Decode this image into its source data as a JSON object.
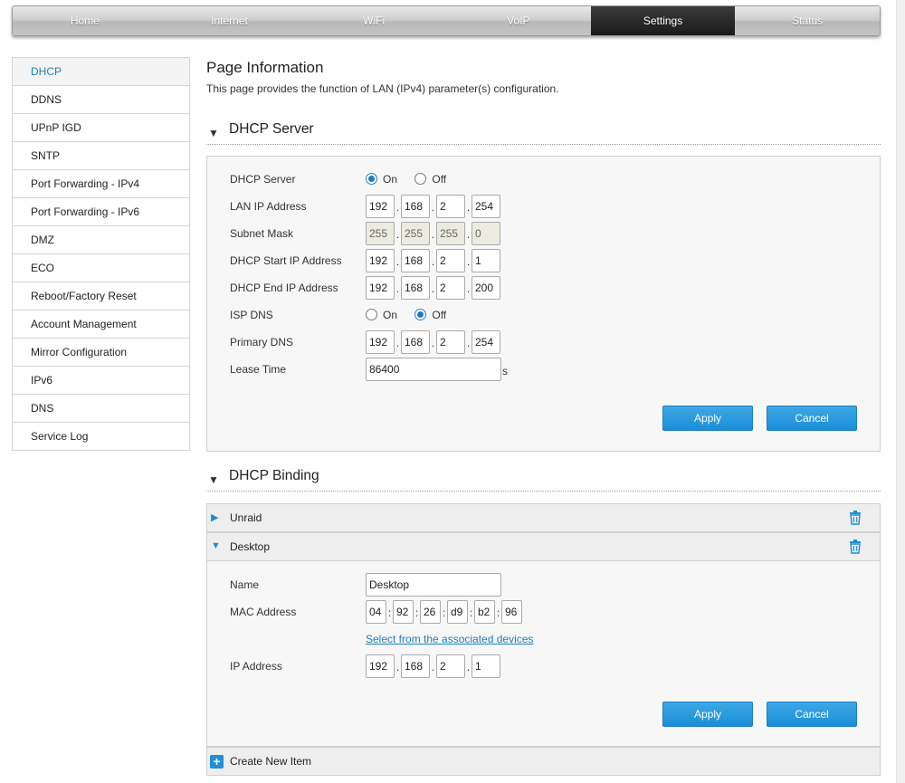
{
  "nav": {
    "tabs": [
      "Home",
      "Internet",
      "WiFi",
      "VoIP",
      "Settings",
      "Status"
    ],
    "active": "Settings"
  },
  "sidebar": {
    "items": [
      "DHCP",
      "DDNS",
      "UPnP IGD",
      "SNTP",
      "Port Forwarding - IPv4",
      "Port Forwarding - IPv6",
      "DMZ",
      "ECO",
      "Reboot/Factory Reset",
      "Account Management",
      "Mirror Configuration",
      "IPv6",
      "DNS",
      "Service Log"
    ],
    "active": "DHCP"
  },
  "page": {
    "title": "Page Information",
    "description": "This page provides the function of LAN (IPv4) parameter(s) configuration."
  },
  "dhcp_server": {
    "section_title": "DHCP Server",
    "server_label": "DHCP Server",
    "server_on": "On",
    "server_off": "Off",
    "server_value": "On",
    "lan_ip_label": "LAN IP Address",
    "lan_ip": [
      "192",
      "168",
      "2",
      "254"
    ],
    "subnet_label": "Subnet Mask",
    "subnet": [
      "255",
      "255",
      "255",
      "0"
    ],
    "start_label": "DHCP Start IP Address",
    "start_ip": [
      "192",
      "168",
      "2",
      "1"
    ],
    "end_label": "DHCP End IP Address",
    "end_ip": [
      "192",
      "168",
      "2",
      "200"
    ],
    "isp_dns_label": "ISP DNS",
    "isp_on": "On",
    "isp_off": "Off",
    "isp_value": "Off",
    "primary_dns_label": "Primary DNS",
    "primary_dns": [
      "192",
      "168",
      "2",
      "254"
    ],
    "lease_label": "Lease Time",
    "lease_value": "86400",
    "lease_unit": "s",
    "apply": "Apply",
    "cancel": "Cancel"
  },
  "dhcp_binding": {
    "section_title": "DHCP Binding",
    "entries": [
      "Unraid",
      "Desktop"
    ],
    "name_label": "Name",
    "name_value": "Desktop",
    "mac_label": "MAC Address",
    "mac": [
      "04",
      "92",
      "26",
      "d9",
      "b2",
      "96"
    ],
    "select_link": "Select from the associated devices",
    "ip_label": "IP Address",
    "ip": [
      "192",
      "168",
      "2",
      "1"
    ],
    "apply": "Apply",
    "cancel": "Cancel",
    "create_new": "Create New Item"
  },
  "colors": {
    "accent": "#1a8fd7",
    "nav_active": "#1a1a1a"
  }
}
